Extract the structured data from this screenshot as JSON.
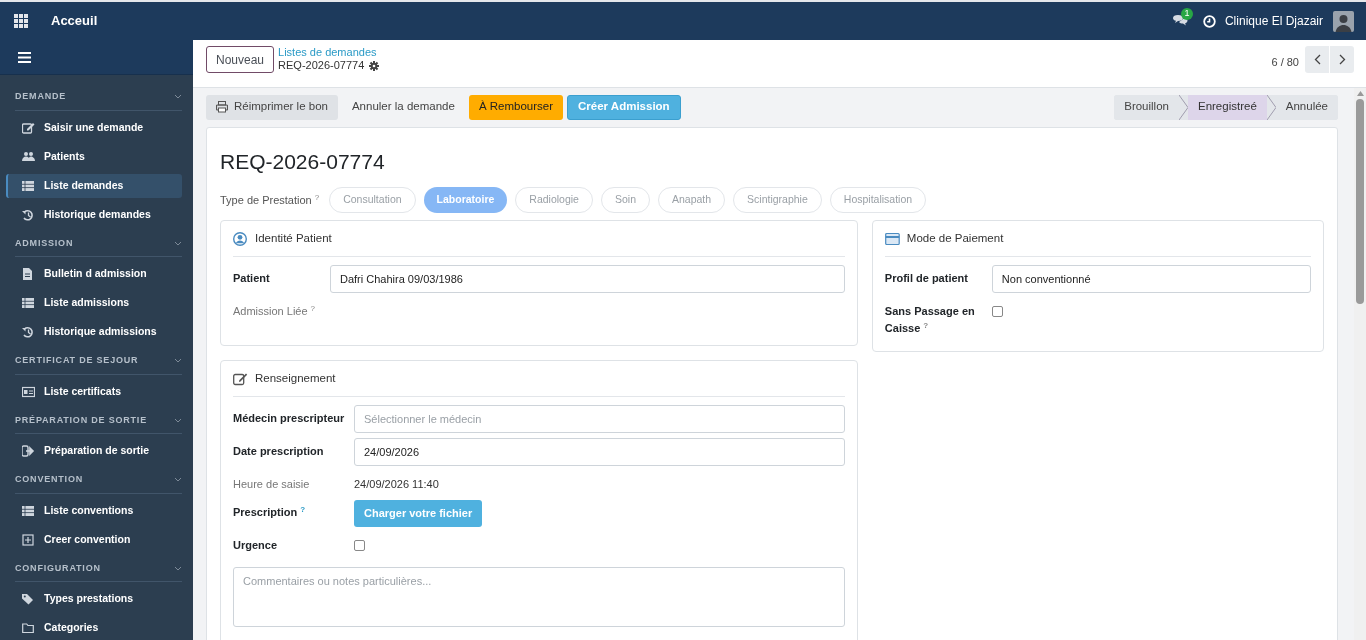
{
  "topbar": {
    "title": "Acceuil",
    "messages_count": "1",
    "company": "Clinique El Djazair"
  },
  "sidebar": {
    "sections": [
      {
        "title": "DEMANDE",
        "items": [
          {
            "label": "Saisir une demande",
            "selected": false
          },
          {
            "label": "Patients",
            "selected": false
          },
          {
            "label": "Liste demandes",
            "selected": true
          },
          {
            "label": "Historique demandes",
            "selected": false
          }
        ]
      },
      {
        "title": "ADMISSION",
        "items": [
          {
            "label": "Bulletin d admission",
            "selected": false
          },
          {
            "label": "Liste admissions",
            "selected": false
          },
          {
            "label": "Historique admissions",
            "selected": false
          }
        ]
      },
      {
        "title": "CERTIFICAT DE SEJOUR",
        "items": [
          {
            "label": "Liste certificats",
            "selected": false
          }
        ]
      },
      {
        "title": "PRÉPARATION DE SORTIE",
        "items": [
          {
            "label": "Préparation de sortie",
            "selected": false
          }
        ]
      },
      {
        "title": "CONVENTION",
        "items": [
          {
            "label": "Liste conventions",
            "selected": false
          },
          {
            "label": "Creer convention",
            "selected": false
          }
        ]
      },
      {
        "title": "CONFIGURATION",
        "items": [
          {
            "label": "Types prestations",
            "selected": false
          },
          {
            "label": "Categories",
            "selected": false
          }
        ]
      }
    ]
  },
  "control_panel": {
    "new_button": "Nouveau",
    "breadcrumb": "Listes de demandes",
    "record": "REQ-2026-07774",
    "pager": "6 / 80"
  },
  "actions": [
    {
      "label": "Réimprimer le bon",
      "kind": "secondary"
    },
    {
      "label": "Annuler la demande",
      "kind": "link"
    },
    {
      "label": "À Rembourser",
      "kind": "warning"
    },
    {
      "label": "Créer Admission",
      "kind": "primary"
    }
  ],
  "statusbar": [
    {
      "label": "Brouillon",
      "selected": false
    },
    {
      "label": "Enregistreé",
      "selected": true
    },
    {
      "label": "Annulée",
      "selected": false
    }
  ],
  "form": {
    "title": "REQ-2026-07774",
    "prestation": {
      "label": "Type de Prestation",
      "help": "?",
      "options": [
        {
          "label": "Consultation",
          "selected": false
        },
        {
          "label": "Laboratoire",
          "selected": true
        },
        {
          "label": "Radiologie",
          "selected": false
        },
        {
          "label": "Soin",
          "selected": false
        },
        {
          "label": "Anapath",
          "selected": false
        },
        {
          "label": "Scintigraphie",
          "selected": false
        },
        {
          "label": "Hospitalisation",
          "selected": false
        }
      ]
    },
    "patient_card": {
      "title": "Identité Patient",
      "fields": [
        {
          "kind": "input",
          "label": "Patient",
          "value": "Dafri Chahira 09/03/1986"
        },
        {
          "kind": "empty",
          "label": "Admission Liée",
          "help": "?"
        }
      ]
    },
    "payment_card": {
      "title": "Mode de Paiement",
      "fields": [
        {
          "kind": "input",
          "label": "Profil de patient",
          "value": "Non conventionné"
        },
        {
          "kind": "checkbox",
          "label": "Sans Passage en Caisse",
          "help": "?",
          "checked": false
        }
      ]
    },
    "info_card": {
      "title": "Renseignement",
      "fields": [
        {
          "kind": "input",
          "label": "Médecin prescripteur",
          "placeholder": "Sélectionner le médecin"
        },
        {
          "kind": "input",
          "label": "Date prescription",
          "value": "24/09/2026"
        },
        {
          "kind": "text",
          "label": "Heure de saisie",
          "value": "24/09/2026 11:40"
        },
        {
          "kind": "button",
          "label": "Prescription",
          "help": "?",
          "button_label": "Charger votre fichier"
        },
        {
          "kind": "checkbox",
          "label": "Urgence",
          "checked": false
        }
      ],
      "comment_placeholder": "Commentaires ou notes particulières..."
    }
  }
}
